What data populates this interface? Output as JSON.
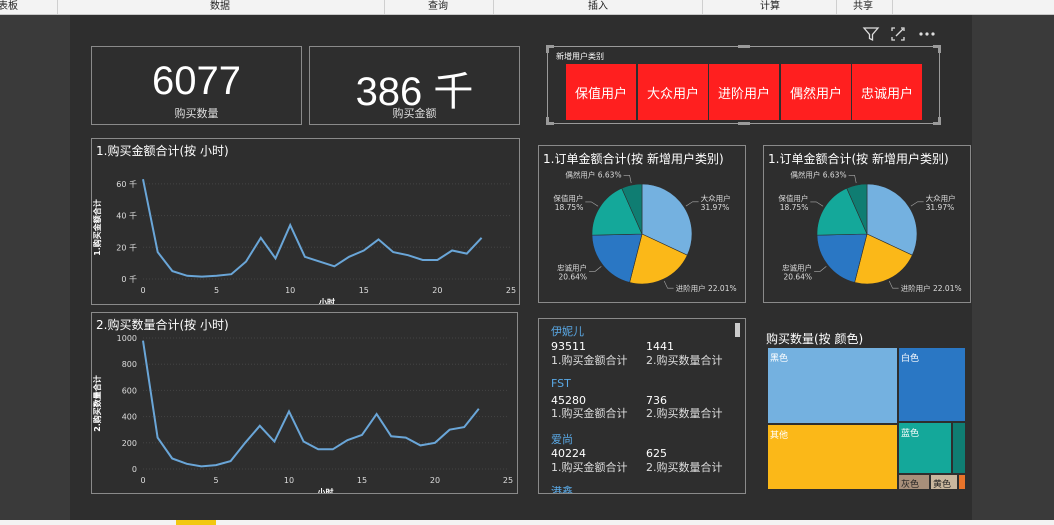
{
  "ribbon": {
    "tabs": [
      "表板",
      "数据",
      "查询",
      "插入",
      "计算",
      "共享"
    ]
  },
  "kpis": [
    {
      "value": "6077",
      "label": "购买数量"
    },
    {
      "value": "386 千",
      "label": "购买金额"
    }
  ],
  "slicer": {
    "title": "新增用户类别",
    "options": [
      "保值用户",
      "大众用户",
      "进阶用户",
      "偶然用户",
      "忠诚用户"
    ]
  },
  "toolbar": {
    "icons": [
      "filter-icon",
      "focus-mode-icon",
      "more-options-icon"
    ]
  },
  "line_chart_1": {
    "title": "1.购买金额合计(按 小时)"
  },
  "line_chart_2": {
    "title": "2.购买数量合计(按 小时)"
  },
  "pie_titles": [
    "1.订单金额合计(按 新增用户类别)",
    "1.订单金额合计(按 新增用户类别)"
  ],
  "list": {
    "items": [
      {
        "name": "伊妮儿",
        "amount": "93511",
        "qty": "1441",
        "amount_label": "1.购买金额合计",
        "qty_label": "2.购买数量合计"
      },
      {
        "name": "FST",
        "amount": "45280",
        "qty": "736",
        "amount_label": "1.购买金额合计",
        "qty_label": "2.购买数量合计"
      },
      {
        "name": "爱尚",
        "amount": "40224",
        "qty": "625",
        "amount_label": "1.购买金额合计",
        "qty_label": "2.购买数量合计"
      },
      {
        "name": "港鑫",
        "amount": "",
        "qty": "",
        "amount_label": "",
        "qty_label": ""
      }
    ]
  },
  "treemap": {
    "title": "购买数量(按 颜色)"
  },
  "colors": {
    "series": "#6aa6d8",
    "blue_light": "#74b1e0",
    "blue_dark": "#2a77c4",
    "yellow": "#fbb818",
    "teal": "#14a89a",
    "teal_dark": "#0f7d72",
    "accent_red": "#ff1f1f"
  },
  "chart_data": [
    {
      "type": "line",
      "title": "1.购买金额合计(按 小时)",
      "xlabel": "小时",
      "ylabel": "1.购买金额合计",
      "x": [
        0,
        1,
        2,
        3,
        4,
        5,
        6,
        7,
        8,
        9,
        10,
        11,
        12,
        13,
        14,
        15,
        16,
        17,
        18,
        19,
        20,
        21,
        22,
        23
      ],
      "values": [
        63,
        17,
        5,
        2,
        1.5,
        2,
        3,
        11,
        26,
        13,
        34,
        14,
        11,
        8,
        14,
        18,
        25,
        17,
        15,
        12,
        12,
        18,
        16,
        26
      ],
      "xticks": [
        0,
        5,
        10,
        15,
        20,
        25
      ],
      "yticks": [
        0,
        20,
        40,
        60
      ],
      "ytick_labels": [
        "0 千",
        "20 千",
        "40 千",
        "60 千"
      ],
      "xlim": [
        0,
        25
      ],
      "ylim": [
        0,
        65
      ]
    },
    {
      "type": "line",
      "title": "2.购买数量合计(按 小时)",
      "xlabel": "小时",
      "ylabel": "2.购买数量合计",
      "x": [
        0,
        1,
        2,
        3,
        4,
        5,
        6,
        7,
        8,
        9,
        10,
        11,
        12,
        13,
        14,
        15,
        16,
        17,
        18,
        19,
        20,
        21,
        22,
        23
      ],
      "values": [
        980,
        240,
        80,
        40,
        20,
        30,
        60,
        200,
        330,
        210,
        440,
        210,
        150,
        150,
        220,
        260,
        420,
        250,
        240,
        180,
        200,
        300,
        320,
        460
      ],
      "xticks": [
        0,
        5,
        10,
        15,
        20,
        25
      ],
      "yticks": [
        0,
        200,
        400,
        600,
        800,
        1000
      ],
      "ytick_labels": [
        "0",
        "200",
        "400",
        "600",
        "800",
        "1000"
      ],
      "xlim": [
        0,
        25
      ],
      "ylim": [
        0,
        1000
      ]
    },
    {
      "type": "pie",
      "title": "1.订单金额合计(按 新增用户类别)",
      "slices": [
        {
          "name": "大众用户",
          "pct_label": "31.97%",
          "value": 31.97,
          "color": "#74b1e0"
        },
        {
          "name": "进阶用户",
          "pct_label": "22.01%",
          "value": 22.01,
          "color": "#fbb818"
        },
        {
          "name": "忠诚用户",
          "pct_label": "20.64%",
          "value": 20.64,
          "color": "#2a77c4"
        },
        {
          "name": "保值用户",
          "pct_label": "18.75%",
          "value": 18.75,
          "color": "#14a89a"
        },
        {
          "name": "偶然用户",
          "pct_label": "6.63%",
          "value": 6.63,
          "color": "#0f7d72"
        }
      ]
    },
    {
      "type": "treemap",
      "title": "购买数量(按 颜色)",
      "categories": [
        "黑色",
        "其他",
        "白色",
        "蓝色",
        "灰色",
        "黄色"
      ]
    }
  ]
}
